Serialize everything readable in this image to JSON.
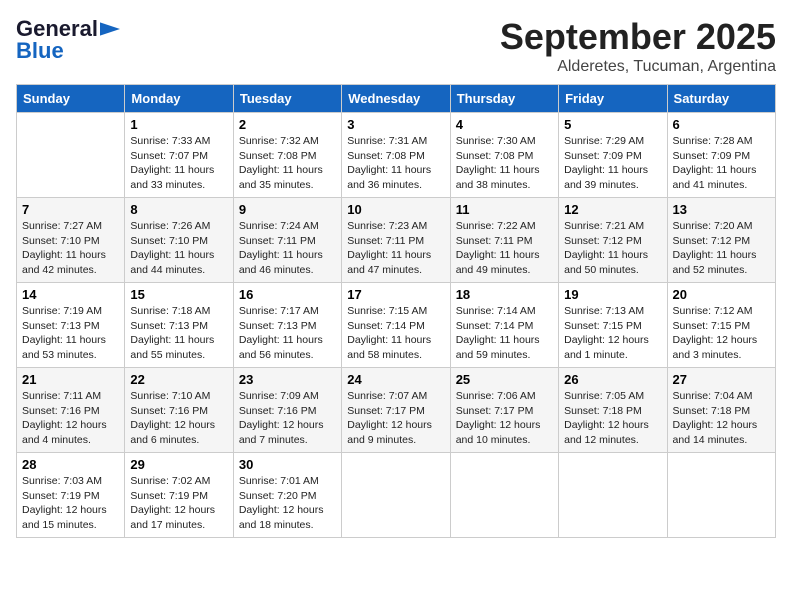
{
  "header": {
    "logo_line1": "General",
    "logo_line2": "Blue",
    "month": "September 2025",
    "location": "Alderetes, Tucuman, Argentina"
  },
  "days_of_week": [
    "Sunday",
    "Monday",
    "Tuesday",
    "Wednesday",
    "Thursday",
    "Friday",
    "Saturday"
  ],
  "weeks": [
    [
      {
        "day": "",
        "info": ""
      },
      {
        "day": "1",
        "info": "Sunrise: 7:33 AM\nSunset: 7:07 PM\nDaylight: 11 hours\nand 33 minutes."
      },
      {
        "day": "2",
        "info": "Sunrise: 7:32 AM\nSunset: 7:08 PM\nDaylight: 11 hours\nand 35 minutes."
      },
      {
        "day": "3",
        "info": "Sunrise: 7:31 AM\nSunset: 7:08 PM\nDaylight: 11 hours\nand 36 minutes."
      },
      {
        "day": "4",
        "info": "Sunrise: 7:30 AM\nSunset: 7:08 PM\nDaylight: 11 hours\nand 38 minutes."
      },
      {
        "day": "5",
        "info": "Sunrise: 7:29 AM\nSunset: 7:09 PM\nDaylight: 11 hours\nand 39 minutes."
      },
      {
        "day": "6",
        "info": "Sunrise: 7:28 AM\nSunset: 7:09 PM\nDaylight: 11 hours\nand 41 minutes."
      }
    ],
    [
      {
        "day": "7",
        "info": "Sunrise: 7:27 AM\nSunset: 7:10 PM\nDaylight: 11 hours\nand 42 minutes."
      },
      {
        "day": "8",
        "info": "Sunrise: 7:26 AM\nSunset: 7:10 PM\nDaylight: 11 hours\nand 44 minutes."
      },
      {
        "day": "9",
        "info": "Sunrise: 7:24 AM\nSunset: 7:11 PM\nDaylight: 11 hours\nand 46 minutes."
      },
      {
        "day": "10",
        "info": "Sunrise: 7:23 AM\nSunset: 7:11 PM\nDaylight: 11 hours\nand 47 minutes."
      },
      {
        "day": "11",
        "info": "Sunrise: 7:22 AM\nSunset: 7:11 PM\nDaylight: 11 hours\nand 49 minutes."
      },
      {
        "day": "12",
        "info": "Sunrise: 7:21 AM\nSunset: 7:12 PM\nDaylight: 11 hours\nand 50 minutes."
      },
      {
        "day": "13",
        "info": "Sunrise: 7:20 AM\nSunset: 7:12 PM\nDaylight: 11 hours\nand 52 minutes."
      }
    ],
    [
      {
        "day": "14",
        "info": "Sunrise: 7:19 AM\nSunset: 7:13 PM\nDaylight: 11 hours\nand 53 minutes."
      },
      {
        "day": "15",
        "info": "Sunrise: 7:18 AM\nSunset: 7:13 PM\nDaylight: 11 hours\nand 55 minutes."
      },
      {
        "day": "16",
        "info": "Sunrise: 7:17 AM\nSunset: 7:13 PM\nDaylight: 11 hours\nand 56 minutes."
      },
      {
        "day": "17",
        "info": "Sunrise: 7:15 AM\nSunset: 7:14 PM\nDaylight: 11 hours\nand 58 minutes."
      },
      {
        "day": "18",
        "info": "Sunrise: 7:14 AM\nSunset: 7:14 PM\nDaylight: 11 hours\nand 59 minutes."
      },
      {
        "day": "19",
        "info": "Sunrise: 7:13 AM\nSunset: 7:15 PM\nDaylight: 12 hours\nand 1 minute."
      },
      {
        "day": "20",
        "info": "Sunrise: 7:12 AM\nSunset: 7:15 PM\nDaylight: 12 hours\nand 3 minutes."
      }
    ],
    [
      {
        "day": "21",
        "info": "Sunrise: 7:11 AM\nSunset: 7:16 PM\nDaylight: 12 hours\nand 4 minutes."
      },
      {
        "day": "22",
        "info": "Sunrise: 7:10 AM\nSunset: 7:16 PM\nDaylight: 12 hours\nand 6 minutes."
      },
      {
        "day": "23",
        "info": "Sunrise: 7:09 AM\nSunset: 7:16 PM\nDaylight: 12 hours\nand 7 minutes."
      },
      {
        "day": "24",
        "info": "Sunrise: 7:07 AM\nSunset: 7:17 PM\nDaylight: 12 hours\nand 9 minutes."
      },
      {
        "day": "25",
        "info": "Sunrise: 7:06 AM\nSunset: 7:17 PM\nDaylight: 12 hours\nand 10 minutes."
      },
      {
        "day": "26",
        "info": "Sunrise: 7:05 AM\nSunset: 7:18 PM\nDaylight: 12 hours\nand 12 minutes."
      },
      {
        "day": "27",
        "info": "Sunrise: 7:04 AM\nSunset: 7:18 PM\nDaylight: 12 hours\nand 14 minutes."
      }
    ],
    [
      {
        "day": "28",
        "info": "Sunrise: 7:03 AM\nSunset: 7:19 PM\nDaylight: 12 hours\nand 15 minutes."
      },
      {
        "day": "29",
        "info": "Sunrise: 7:02 AM\nSunset: 7:19 PM\nDaylight: 12 hours\nand 17 minutes."
      },
      {
        "day": "30",
        "info": "Sunrise: 7:01 AM\nSunset: 7:20 PM\nDaylight: 12 hours\nand 18 minutes."
      },
      {
        "day": "",
        "info": ""
      },
      {
        "day": "",
        "info": ""
      },
      {
        "day": "",
        "info": ""
      },
      {
        "day": "",
        "info": ""
      }
    ]
  ]
}
